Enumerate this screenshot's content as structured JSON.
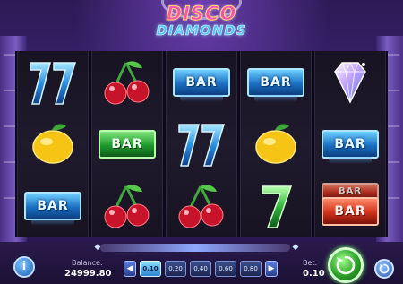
{
  "game": {
    "title_top": "DISCO",
    "title_bottom": "DIAMONDS"
  },
  "reels": [
    [
      "seven-blue",
      "lemon",
      "bar-blue"
    ],
    [
      "cherry",
      "bar-green",
      "cherry"
    ],
    [
      "bar-blue",
      "seven-blue",
      "cherry"
    ],
    [
      "bar-blue",
      "lemon",
      "seven-green"
    ],
    [
      "diamond",
      "bar-blue",
      "bar-red"
    ]
  ],
  "bar_text": "BAR",
  "controls": {
    "balance_label": "Balance:",
    "balance_value": "24999.80",
    "bet_label": "Bet:",
    "bet_value": "0.10",
    "chips": [
      "0.10",
      "0.20",
      "0.40",
      "0.60",
      "0.80"
    ],
    "active_chip": 0,
    "info_label": "i"
  },
  "colors": {
    "background": "#2d1a55",
    "reel_bg": "#1a1626",
    "spin": "#2da12a",
    "accent": "#4fc3ff"
  }
}
